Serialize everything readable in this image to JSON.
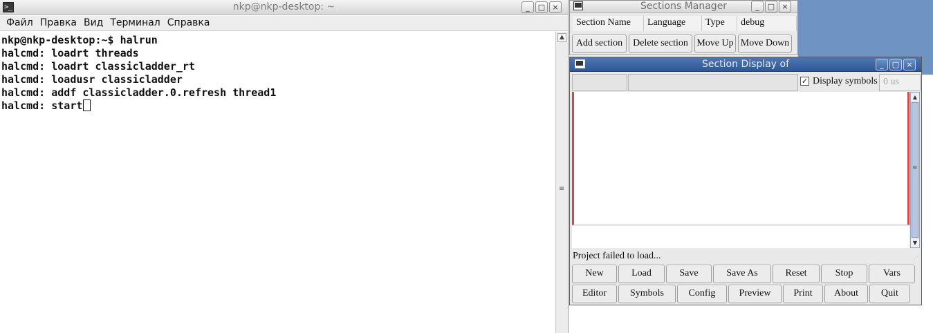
{
  "terminal": {
    "title": "nkp@nkp-desktop: ~",
    "icon": "terminal-icon",
    "menu": [
      {
        "label": "Файл"
      },
      {
        "label": "Правка"
      },
      {
        "label": "Вид"
      },
      {
        "label": "Терминал"
      },
      {
        "label": "Справка"
      }
    ],
    "lines": [
      "nkp@nkp-desktop:~$ halrun",
      "halcmd: loadrt threads",
      "halcmd: loadrt classicladder_rt",
      "halcmd: loadusr classicladder",
      "halcmd: addf classicladder.0.refresh thread1",
      "halcmd: start"
    ]
  },
  "window_controls": {
    "minimize": "_",
    "maximize": "□",
    "close": "×"
  },
  "sections_manager": {
    "title": "Sections Manager",
    "columns": [
      "Section Name",
      "Language",
      "Type",
      "debug"
    ],
    "buttons": [
      "Add section",
      "Delete section",
      "Move Up",
      "Move Down"
    ]
  },
  "section_display": {
    "title": "Section Display of",
    "display_symbols_label": "Display symbols",
    "display_symbols_checked": "✓",
    "time_placeholder": "0 us",
    "status": "Project failed to load...",
    "row1_buttons": [
      "New",
      "Load",
      "Save",
      "Save As",
      "Reset",
      "Stop",
      "Vars"
    ],
    "row2_buttons": [
      "Editor",
      "Symbols",
      "Config",
      "Preview",
      "Print",
      "About",
      "Quit"
    ]
  },
  "colors": {
    "desktop": "#6f94c4",
    "active_titlebar": "#3a64a2",
    "ladder_rail": "#d04848"
  }
}
